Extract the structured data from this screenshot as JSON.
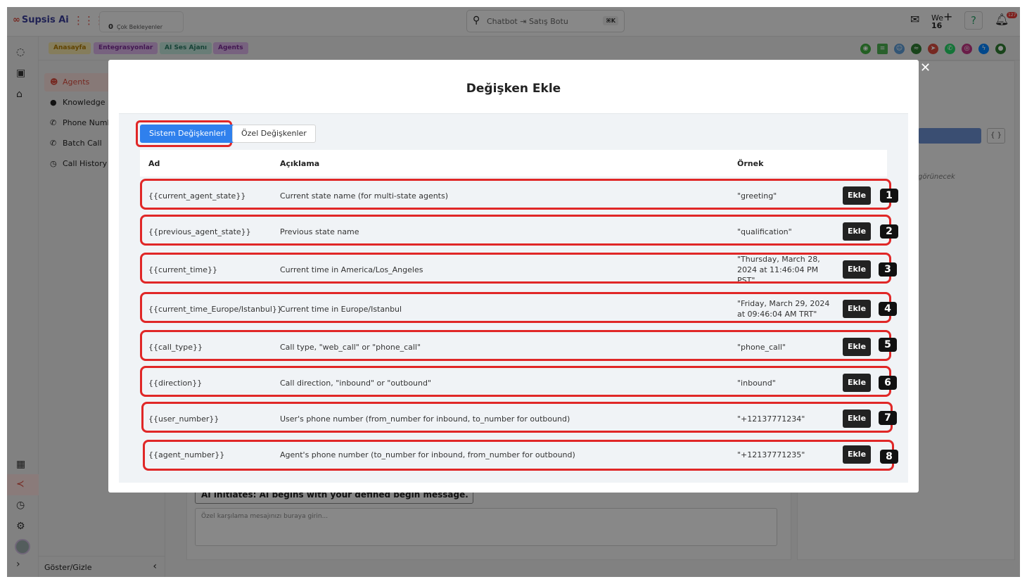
{
  "topbar": {
    "brand": "Supsis Ai",
    "waiting_count": "0",
    "waiting_label": "Çok Bekleyenler",
    "search_text": "Chatbot ⇥ Satış Botu",
    "search_kbd": "⌘K",
    "we_label": "We",
    "we_num": "16",
    "notif_count": "127"
  },
  "subbar": {
    "pills": [
      "Anasayfa",
      "Entegrasyonlar",
      "AI Ses Ajanı",
      "Agents"
    ]
  },
  "sidemenu": {
    "items": [
      "Agents",
      "Knowledge B",
      "Phone Numb",
      "Batch Call",
      "Call History"
    ],
    "toggle_label": "Göster/Gizle"
  },
  "background": {
    "hint": "görünecek",
    "dropdown": "AI initiates: AI begins with your defined begin message.",
    "textarea_placeholder": "Özel karşılama mesajınızı buraya girin..."
  },
  "modal": {
    "title": "Değişken Ekle",
    "tabs": [
      "Sistem Değişkenleri",
      "Özel Değişkenler"
    ],
    "columns": [
      "Ad",
      "Açıklama",
      "Örnek"
    ],
    "add_label": "Ekle",
    "rows": [
      {
        "name": "{{current_agent_state}}",
        "desc": "Current state name (for multi-state agents)",
        "example": "\"greeting\"",
        "badge": "1"
      },
      {
        "name": "{{previous_agent_state}}",
        "desc": "Previous state name",
        "example": "\"qualification\"",
        "badge": "2"
      },
      {
        "name": "{{current_time}}",
        "desc": "Current time in America/Los_Angeles",
        "example": "\"Thursday, March 28, 2024 at 11:46:04 PM PST\"",
        "badge": "3"
      },
      {
        "name": "{{current_time_Europe/Istanbul}}",
        "desc": "Current time in Europe/Istanbul",
        "example": "\"Friday, March 29, 2024 at 09:46:04 AM TRT\"",
        "badge": "4"
      },
      {
        "name": "{{call_type}}",
        "desc": "Call type, \"web_call\" or \"phone_call\"",
        "example": "\"phone_call\"",
        "badge": "5"
      },
      {
        "name": "{{direction}}",
        "desc": "Call direction, \"inbound\" or \"outbound\"",
        "example": "\"inbound\"",
        "badge": "6"
      },
      {
        "name": "{{user_number}}",
        "desc": "User's phone number (from_number for inbound, to_number for outbound)",
        "example": "\"+12137771234\"",
        "badge": "7"
      },
      {
        "name": "{{agent_number}}",
        "desc": "Agent's phone number (to_number for inbound, from_number for outbound)",
        "example": "\"+12137771235\"",
        "badge": "8"
      }
    ]
  },
  "colors": {
    "accent": "#2f80ed",
    "brand": "#d84b3e",
    "highlight": "#e02727"
  }
}
